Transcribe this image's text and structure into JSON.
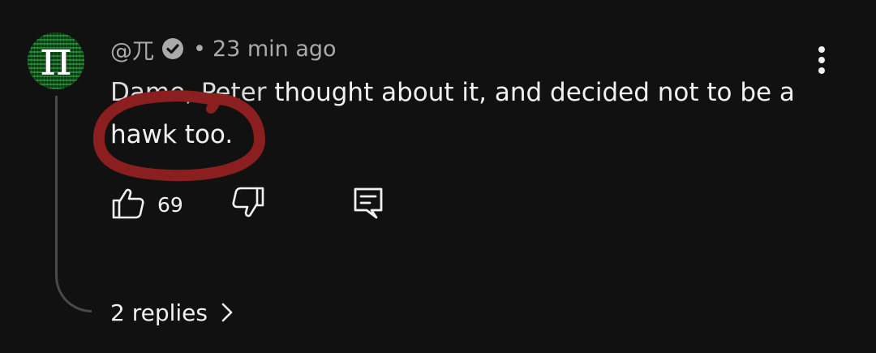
{
  "comment": {
    "author": "@兀",
    "separator": "•",
    "time": "23 min ago",
    "text_obscured": "Dame, Peter",
    "text_visible": " thought about it, and decided not to be a hawk too.",
    "avatar_glyph": "π",
    "avatar_colors": {
      "bg": "#0b3d14",
      "pattern": "#46c85a"
    },
    "verified_icon": "check-circle-icon",
    "menu_icon": "more-vert-icon",
    "annotation_color": "#8b1e1e"
  },
  "actions": {
    "like_icon": "thumb-up-icon",
    "like_count": "69",
    "dislike_icon": "thumb-down-icon",
    "reply_icon": "comment-icon"
  },
  "replies": {
    "label": "2 replies",
    "icon": "chevron-right-icon"
  }
}
